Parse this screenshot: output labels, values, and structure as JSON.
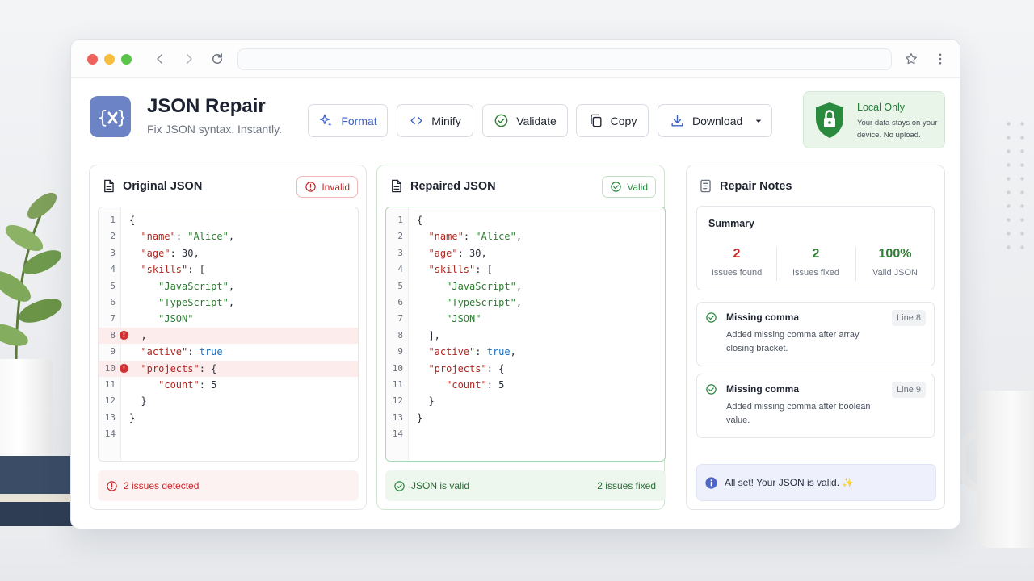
{
  "app": {
    "title": "JSON Repair",
    "subtitle": "Fix JSON syntax. Instantly.",
    "logo_icon": "json-repair-logo-icon"
  },
  "toolbar": {
    "format_label": "Format",
    "minify_label": "Minify",
    "validate_label": "Validate",
    "copy_label": "Copy",
    "download_label": "Download"
  },
  "local_badge": {
    "title": "Local Only",
    "description": "Your data stays on your device. No upload."
  },
  "original": {
    "title": "Original JSON",
    "badge": "Invalid",
    "footer": "2 issues detected",
    "lines": [
      {
        "n": "1",
        "code": "{",
        "error": false
      },
      {
        "n": "2",
        "code": "  \"name\": \"Alice\",",
        "error": false
      },
      {
        "n": "3",
        "code": "  \"age\": 30,",
        "error": false
      },
      {
        "n": "4",
        "code": "  \"skills\": [",
        "error": false
      },
      {
        "n": "5",
        "code": "     \"JavaScript\",",
        "error": false
      },
      {
        "n": "6",
        "code": "     \"TypeScript\",",
        "error": false
      },
      {
        "n": "7",
        "code": "     \"JSON\"",
        "error": false
      },
      {
        "n": "8",
        "code": "  ,",
        "error": true
      },
      {
        "n": "9",
        "code": "  \"active\": true",
        "error": false
      },
      {
        "n": "10",
        "code": "  \"projects\": {",
        "error": true
      },
      {
        "n": "11",
        "code": "     \"count\": 5",
        "error": false
      },
      {
        "n": "12",
        "code": "  }",
        "error": false
      },
      {
        "n": "13",
        "code": "}",
        "error": false
      },
      {
        "n": "14",
        "code": "",
        "error": false
      }
    ]
  },
  "repaired": {
    "title": "Repaired JSON",
    "badge": "Valid",
    "footer_left": "JSON is valid",
    "footer_right": "2 issues fixed",
    "lines": [
      {
        "n": "1",
        "code": "{"
      },
      {
        "n": "2",
        "code": "  \"name\": \"Alice\","
      },
      {
        "n": "3",
        "code": "  \"age\": 30,"
      },
      {
        "n": "4",
        "code": "  \"skills\": ["
      },
      {
        "n": "5",
        "code": "     \"JavaScript\","
      },
      {
        "n": "6",
        "code": "     \"TypeScript\","
      },
      {
        "n": "7",
        "code": "     \"JSON\""
      },
      {
        "n": "8",
        "code": "  ],"
      },
      {
        "n": "9",
        "code": "  \"active\": true,"
      },
      {
        "n": "10",
        "code": "  \"projects\": {"
      },
      {
        "n": "11",
        "code": "     \"count\": 5"
      },
      {
        "n": "12",
        "code": "  }"
      },
      {
        "n": "13",
        "code": "}"
      },
      {
        "n": "14",
        "code": ""
      }
    ]
  },
  "notes": {
    "title": "Repair Notes",
    "summary": {
      "title": "Summary",
      "stats": [
        {
          "value": "2",
          "label": "Issues found",
          "color": "#c62828"
        },
        {
          "value": "2",
          "label": "Issues fixed",
          "color": "#2e7d32"
        },
        {
          "value": "100%",
          "label": "Valid JSON",
          "color": "#2e7d32"
        }
      ]
    },
    "items": [
      {
        "title": "Missing comma",
        "line": "Line 8",
        "description": "Added missing comma after array closing bracket."
      },
      {
        "title": "Missing comma",
        "line": "Line 9",
        "description": "Added missing comma after boolean value."
      }
    ],
    "final_message": "All set! Your JSON is valid. ✨"
  },
  "colors": {
    "accent": "#3f62c4",
    "error": "#c62828",
    "success": "#2e7d32",
    "logo_bg": "#6c83c6"
  }
}
